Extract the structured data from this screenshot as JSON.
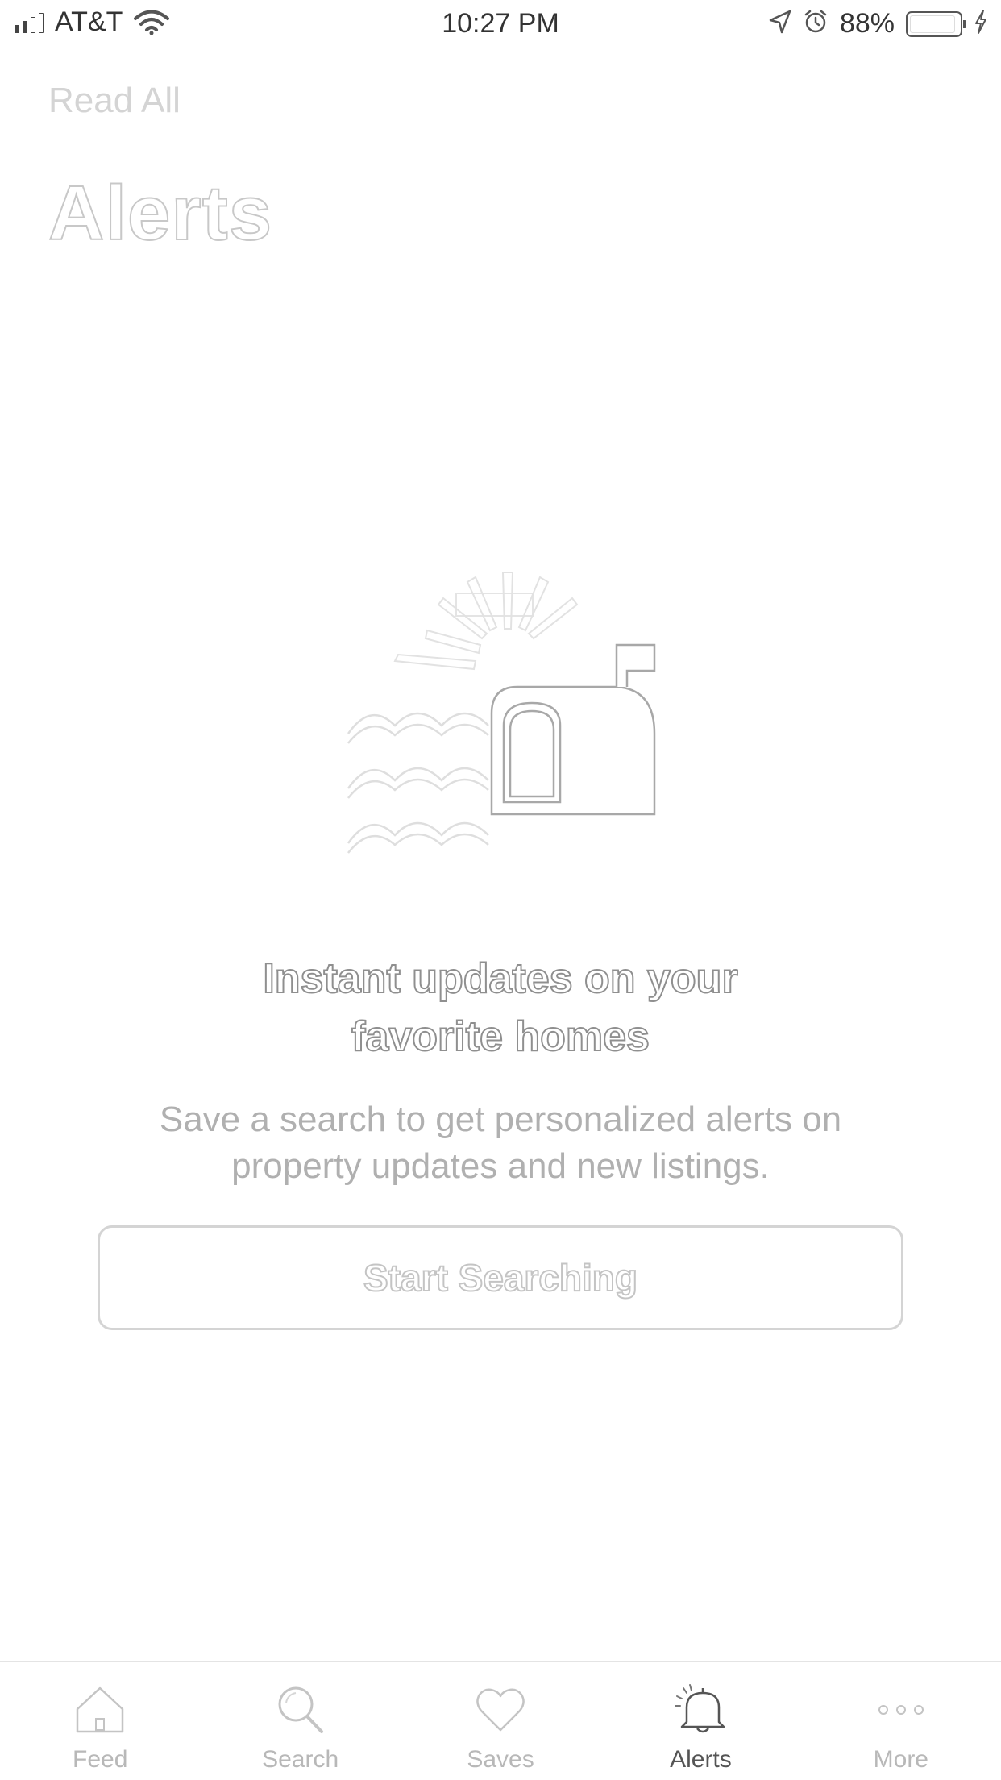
{
  "status_bar": {
    "carrier": "AT&T",
    "time": "10:27 PM",
    "battery_percent": "88%",
    "signal_bars": 2,
    "signal_total": 4,
    "battery_level": 0.88
  },
  "header": {
    "read_all_label": "Read All",
    "title": "Alerts"
  },
  "empty_state": {
    "heading_line1": "Instant updates on your",
    "heading_line2": "favorite homes",
    "body_line1": "Save a search to get personalized alerts on",
    "body_line2": "property updates and new listings.",
    "button_label": "Start Searching"
  },
  "tab_bar": {
    "items": [
      {
        "label": "Feed",
        "icon": "house-icon",
        "active": false
      },
      {
        "label": "Search",
        "icon": "search-icon",
        "active": false
      },
      {
        "label": "Saves",
        "icon": "heart-icon",
        "active": false
      },
      {
        "label": "Alerts",
        "icon": "bell-icon",
        "active": true
      },
      {
        "label": "More",
        "icon": "more-dots-icon",
        "active": false
      }
    ]
  },
  "colors": {
    "text_primary": "#333333",
    "text_muted": "#b0b0b0",
    "outline_gray": "#c8c8c8",
    "active_tab": "#555555",
    "inactive_tab": "#b8b8b8"
  }
}
